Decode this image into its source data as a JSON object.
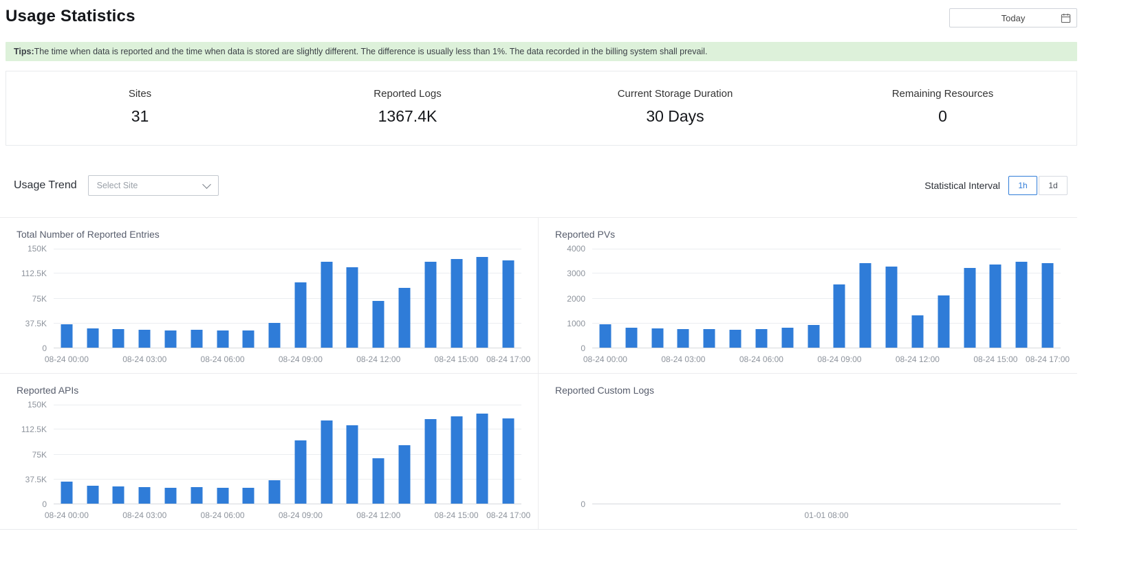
{
  "header": {
    "title": "Usage Statistics",
    "date_range_label": "Today"
  },
  "tips": {
    "prefix": "Tips:",
    "text": "The time when data is reported and the time when data is stored are slightly different. The difference is usually less than 1%. The data recorded in the billing system shall prevail."
  },
  "stats": [
    {
      "label": "Sites",
      "value": "31"
    },
    {
      "label": "Reported Logs",
      "value": "1367.4K"
    },
    {
      "label": "Current Storage Duration",
      "value": "30 Days"
    },
    {
      "label": "Remaining Resources",
      "value": "0"
    }
  ],
  "trend": {
    "title": "Usage Trend",
    "site_select_placeholder": "Select Site",
    "interval_label": "Statistical Interval",
    "intervals": [
      {
        "label": "1h",
        "selected": true
      },
      {
        "label": "1d",
        "selected": false
      }
    ]
  },
  "colors": {
    "bar": "#2f7cd8",
    "accent": "#2f7cd8",
    "tips_bg": "#ddf1da"
  },
  "chart_data": [
    {
      "type": "bar",
      "title": "Total Number of Reported Entries",
      "ylim": [
        0,
        150000
      ],
      "y_ticks": [
        "0",
        "37.5K",
        "75K",
        "112.5K",
        "150K"
      ],
      "x": [
        "08-24 00:00",
        "08-24 01:00",
        "08-24 02:00",
        "08-24 03:00",
        "08-24 04:00",
        "08-24 05:00",
        "08-24 06:00",
        "08-24 07:00",
        "08-24 08:00",
        "08-24 09:00",
        "08-24 10:00",
        "08-24 11:00",
        "08-24 12:00",
        "08-24 13:00",
        "08-24 14:00",
        "08-24 15:00",
        "08-24 16:00",
        "08-24 17:00"
      ],
      "values": [
        35000,
        29000,
        28000,
        27000,
        26000,
        27000,
        26000,
        26000,
        37000,
        98000,
        129000,
        121000,
        70000,
        90000,
        129000,
        133000,
        137000,
        131000
      ],
      "x_tick_indices": [
        0,
        3,
        6,
        9,
        12,
        15,
        17
      ]
    },
    {
      "type": "bar",
      "title": "Reported PVs",
      "ylim": [
        0,
        4000
      ],
      "y_ticks": [
        "0",
        "1000",
        "2000",
        "3000",
        "4000"
      ],
      "x": [
        "08-24 00:00",
        "08-24 01:00",
        "08-24 02:00",
        "08-24 03:00",
        "08-24 04:00",
        "08-24 05:00",
        "08-24 06:00",
        "08-24 07:00",
        "08-24 08:00",
        "08-24 09:00",
        "08-24 10:00",
        "08-24 11:00",
        "08-24 12:00",
        "08-24 13:00",
        "08-24 14:00",
        "08-24 15:00",
        "08-24 16:00",
        "08-24 17:00"
      ],
      "values": [
        950,
        800,
        770,
        740,
        750,
        730,
        740,
        790,
        920,
        2550,
        3400,
        3250,
        1300,
        2100,
        3200,
        3350,
        3450,
        3380
      ],
      "x_tick_indices": [
        0,
        3,
        6,
        9,
        12,
        15,
        17
      ]
    },
    {
      "type": "bar",
      "title": "Reported APIs",
      "ylim": [
        0,
        150000
      ],
      "y_ticks": [
        "0",
        "37.5K",
        "75K",
        "112.5K",
        "150K"
      ],
      "x": [
        "08-24 00:00",
        "08-24 01:00",
        "08-24 02:00",
        "08-24 03:00",
        "08-24 04:00",
        "08-24 05:00",
        "08-24 06:00",
        "08-24 07:00",
        "08-24 08:00",
        "08-24 09:00",
        "08-24 10:00",
        "08-24 11:00",
        "08-24 12:00",
        "08-24 13:00",
        "08-24 14:00",
        "08-24 15:00",
        "08-24 16:00",
        "08-24 17:00"
      ],
      "values": [
        33000,
        27000,
        26000,
        25000,
        24000,
        25000,
        24000,
        24000,
        35000,
        95000,
        125000,
        118000,
        68000,
        88000,
        127000,
        131000,
        136000,
        128000
      ],
      "x_tick_indices": [
        0,
        3,
        6,
        9,
        12,
        15,
        17
      ]
    },
    {
      "type": "bar",
      "title": "Reported Custom Logs",
      "ylim": [
        0,
        1
      ],
      "y_ticks": [
        "0"
      ],
      "x": [],
      "values": [],
      "x_tick_indices": [],
      "x_center_label": "01-01 08:00"
    }
  ]
}
